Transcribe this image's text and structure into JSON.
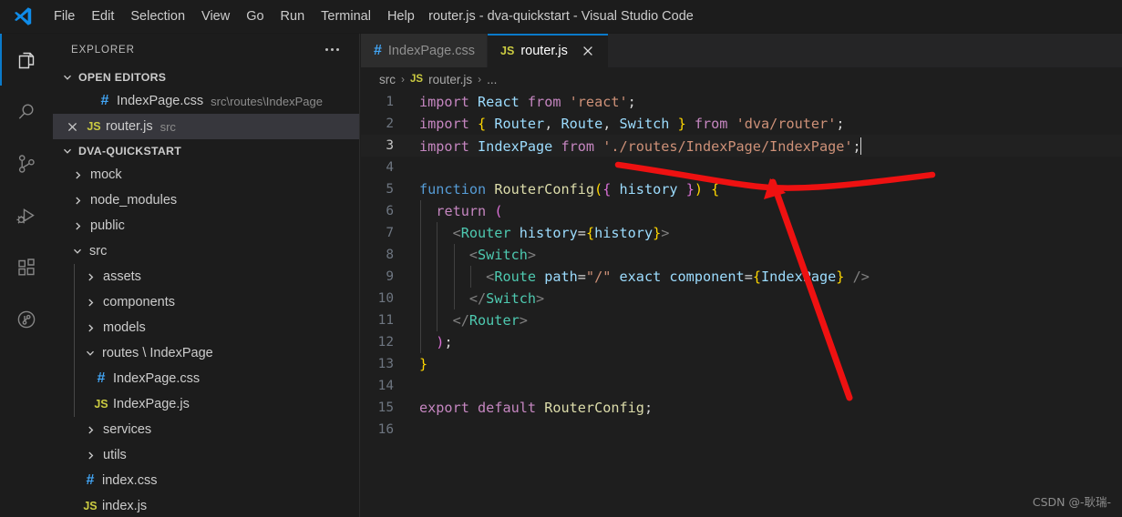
{
  "window": {
    "title": "router.js - dva-quickstart - Visual Studio Code",
    "logo_icon": "vscode-logo-icon"
  },
  "menu": {
    "items": [
      {
        "label": "File"
      },
      {
        "label": "Edit"
      },
      {
        "label": "Selection"
      },
      {
        "label": "View"
      },
      {
        "label": "Go"
      },
      {
        "label": "Run"
      },
      {
        "label": "Terminal"
      },
      {
        "label": "Help"
      }
    ]
  },
  "activity_bar": {
    "items": [
      {
        "name": "explorer",
        "icon": "files-icon",
        "active": true
      },
      {
        "name": "search",
        "icon": "search-icon",
        "active": false
      },
      {
        "name": "source-control",
        "icon": "source-control-icon",
        "active": false
      },
      {
        "name": "run-and-debug",
        "icon": "run-debug-icon",
        "active": false
      },
      {
        "name": "extensions",
        "icon": "extensions-icon",
        "active": false
      },
      {
        "name": "timeline",
        "icon": "timeline-circle-icon",
        "active": false
      }
    ]
  },
  "sidebar": {
    "title": "EXPLORER",
    "more_actions_icon": "ellipsis-icon",
    "open_editors": {
      "label": "OPEN EDITORS",
      "expanded": true,
      "items": [
        {
          "name": "IndexPage.css",
          "path": "src\\routes\\IndexPage",
          "filetype": "css",
          "selected": false,
          "show_close": false
        },
        {
          "name": "router.js",
          "path": "src",
          "filetype": "js",
          "selected": true,
          "show_close": true
        }
      ]
    },
    "project": {
      "label": "DVA-QUICKSTART",
      "expanded": true,
      "tree": [
        {
          "label": "mock",
          "kind": "folder",
          "expanded": false,
          "depth": 0
        },
        {
          "label": "node_modules",
          "kind": "folder",
          "expanded": false,
          "depth": 0
        },
        {
          "label": "public",
          "kind": "folder",
          "expanded": false,
          "depth": 0
        },
        {
          "label": "src",
          "kind": "folder",
          "expanded": true,
          "depth": 0
        },
        {
          "label": "assets",
          "kind": "folder",
          "expanded": false,
          "depth": 1
        },
        {
          "label": "components",
          "kind": "folder",
          "expanded": false,
          "depth": 1
        },
        {
          "label": "models",
          "kind": "folder",
          "expanded": false,
          "depth": 1
        },
        {
          "label": "routes \\ IndexPage",
          "kind": "folder",
          "expanded": true,
          "depth": 1
        },
        {
          "label": "IndexPage.css",
          "kind": "file",
          "filetype": "css",
          "depth": 2
        },
        {
          "label": "IndexPage.js",
          "kind": "file",
          "filetype": "js",
          "depth": 2
        },
        {
          "label": "services",
          "kind": "folder",
          "expanded": false,
          "depth": 1
        },
        {
          "label": "utils",
          "kind": "folder",
          "expanded": false,
          "depth": 1
        },
        {
          "label": "index.css",
          "kind": "file",
          "filetype": "css",
          "depth": 1
        },
        {
          "label": "index.js",
          "kind": "file",
          "filetype": "js",
          "depth": 1
        }
      ]
    }
  },
  "editor": {
    "tabs": [
      {
        "label": "IndexPage.css",
        "filetype": "css",
        "active": false,
        "closable": false
      },
      {
        "label": "router.js",
        "filetype": "js",
        "active": true,
        "closable": true
      }
    ],
    "breadcrumb": {
      "root": "src",
      "file": "router.js",
      "file_type": "JS",
      "trailing": "...",
      "separator": "›"
    },
    "active_line": 3,
    "total_lines": 16,
    "lines": [
      {
        "n": 1,
        "indent": 0,
        "tokens": [
          {
            "t": "import",
            "c": "k"
          },
          {
            "t": " ",
            "c": "op"
          },
          {
            "t": "React",
            "c": "id"
          },
          {
            "t": " ",
            "c": "op"
          },
          {
            "t": "from",
            "c": "k"
          },
          {
            "t": " ",
            "c": "op"
          },
          {
            "t": "'react'",
            "c": "s"
          },
          {
            "t": ";",
            "c": "op"
          }
        ]
      },
      {
        "n": 2,
        "indent": 0,
        "tokens": [
          {
            "t": "import",
            "c": "k"
          },
          {
            "t": " ",
            "c": "op"
          },
          {
            "t": "{",
            "c": "y"
          },
          {
            "t": " ",
            "c": "op"
          },
          {
            "t": "Router",
            "c": "id"
          },
          {
            "t": ", ",
            "c": "op"
          },
          {
            "t": "Route",
            "c": "id"
          },
          {
            "t": ", ",
            "c": "op"
          },
          {
            "t": "Switch",
            "c": "id"
          },
          {
            "t": " ",
            "c": "op"
          },
          {
            "t": "}",
            "c": "y"
          },
          {
            "t": " ",
            "c": "op"
          },
          {
            "t": "from",
            "c": "k"
          },
          {
            "t": " ",
            "c": "op"
          },
          {
            "t": "'dva/router'",
            "c": "s"
          },
          {
            "t": ";",
            "c": "op"
          }
        ]
      },
      {
        "n": 3,
        "indent": 0,
        "cursor": true,
        "tokens": [
          {
            "t": "import",
            "c": "k"
          },
          {
            "t": " ",
            "c": "op"
          },
          {
            "t": "IndexPage",
            "c": "id"
          },
          {
            "t": " ",
            "c": "op"
          },
          {
            "t": "from",
            "c": "k"
          },
          {
            "t": " ",
            "c": "op"
          },
          {
            "t": "'./routes/IndexPage/IndexPage'",
            "c": "s"
          },
          {
            "t": ";",
            "c": "op"
          }
        ]
      },
      {
        "n": 4,
        "indent": 0,
        "tokens": []
      },
      {
        "n": 5,
        "indent": 0,
        "tokens": [
          {
            "t": "function",
            "c": "fn"
          },
          {
            "t": " ",
            "c": "op"
          },
          {
            "t": "RouterConfig",
            "c": "fname-c"
          },
          {
            "t": "(",
            "c": "y"
          },
          {
            "t": "{",
            "c": "p"
          },
          {
            "t": " ",
            "c": "op"
          },
          {
            "t": "history",
            "c": "id"
          },
          {
            "t": " ",
            "c": "op"
          },
          {
            "t": "}",
            "c": "p"
          },
          {
            "t": ")",
            "c": "y"
          },
          {
            "t": " ",
            "c": "op"
          },
          {
            "t": "{",
            "c": "y"
          }
        ]
      },
      {
        "n": 6,
        "indent": 1,
        "tokens": [
          {
            "t": "  ",
            "c": "op"
          },
          {
            "t": "return",
            "c": "k"
          },
          {
            "t": " ",
            "c": "op"
          },
          {
            "t": "(",
            "c": "p"
          }
        ]
      },
      {
        "n": 7,
        "indent": 2,
        "tokens": [
          {
            "t": "    ",
            "c": "op"
          },
          {
            "t": "<",
            "c": "pl"
          },
          {
            "t": "Router",
            "c": "tag"
          },
          {
            "t": " ",
            "c": "op"
          },
          {
            "t": "history",
            "c": "id"
          },
          {
            "t": "=",
            "c": "op"
          },
          {
            "t": "{",
            "c": "y"
          },
          {
            "t": "history",
            "c": "id"
          },
          {
            "t": "}",
            "c": "y"
          },
          {
            "t": ">",
            "c": "pl"
          }
        ]
      },
      {
        "n": 8,
        "indent": 3,
        "tokens": [
          {
            "t": "      ",
            "c": "op"
          },
          {
            "t": "<",
            "c": "pl"
          },
          {
            "t": "Switch",
            "c": "tag"
          },
          {
            "t": ">",
            "c": "pl"
          }
        ]
      },
      {
        "n": 9,
        "indent": 4,
        "tokens": [
          {
            "t": "        ",
            "c": "op"
          },
          {
            "t": "<",
            "c": "pl"
          },
          {
            "t": "Route",
            "c": "tag"
          },
          {
            "t": " ",
            "c": "op"
          },
          {
            "t": "path",
            "c": "id"
          },
          {
            "t": "=",
            "c": "op"
          },
          {
            "t": "\"/\"",
            "c": "s"
          },
          {
            "t": " ",
            "c": "op"
          },
          {
            "t": "exact",
            "c": "id"
          },
          {
            "t": " ",
            "c": "op"
          },
          {
            "t": "component",
            "c": "id"
          },
          {
            "t": "=",
            "c": "op"
          },
          {
            "t": "{",
            "c": "y"
          },
          {
            "t": "IndexPage",
            "c": "id"
          },
          {
            "t": "}",
            "c": "y"
          },
          {
            "t": " ",
            "c": "op"
          },
          {
            "t": "/>",
            "c": "pl"
          }
        ]
      },
      {
        "n": 10,
        "indent": 3,
        "tokens": [
          {
            "t": "      ",
            "c": "op"
          },
          {
            "t": "</",
            "c": "pl"
          },
          {
            "t": "Switch",
            "c": "tag"
          },
          {
            "t": ">",
            "c": "pl"
          }
        ]
      },
      {
        "n": 11,
        "indent": 2,
        "tokens": [
          {
            "t": "    ",
            "c": "op"
          },
          {
            "t": "</",
            "c": "pl"
          },
          {
            "t": "Router",
            "c": "tag"
          },
          {
            "t": ">",
            "c": "pl"
          }
        ]
      },
      {
        "n": 12,
        "indent": 1,
        "tokens": [
          {
            "t": "  ",
            "c": "op"
          },
          {
            "t": ")",
            "c": "p"
          },
          {
            "t": ";",
            "c": "op"
          }
        ]
      },
      {
        "n": 13,
        "indent": 0,
        "tokens": [
          {
            "t": "}",
            "c": "y"
          }
        ]
      },
      {
        "n": 14,
        "indent": 0,
        "tokens": []
      },
      {
        "n": 15,
        "indent": 0,
        "tokens": [
          {
            "t": "export",
            "c": "k"
          },
          {
            "t": " ",
            "c": "op"
          },
          {
            "t": "default",
            "c": "k"
          },
          {
            "t": " ",
            "c": "op"
          },
          {
            "t": "RouterConfig",
            "c": "fname-c"
          },
          {
            "t": ";",
            "c": "op"
          }
        ]
      },
      {
        "n": 16,
        "indent": 0,
        "tokens": []
      }
    ]
  },
  "annotation": {
    "color": "#ee1111",
    "shapes": [
      "underline-stroke",
      "down-arrow-with-head"
    ]
  },
  "watermark": {
    "text": "CSDN @-耿瑞-"
  }
}
